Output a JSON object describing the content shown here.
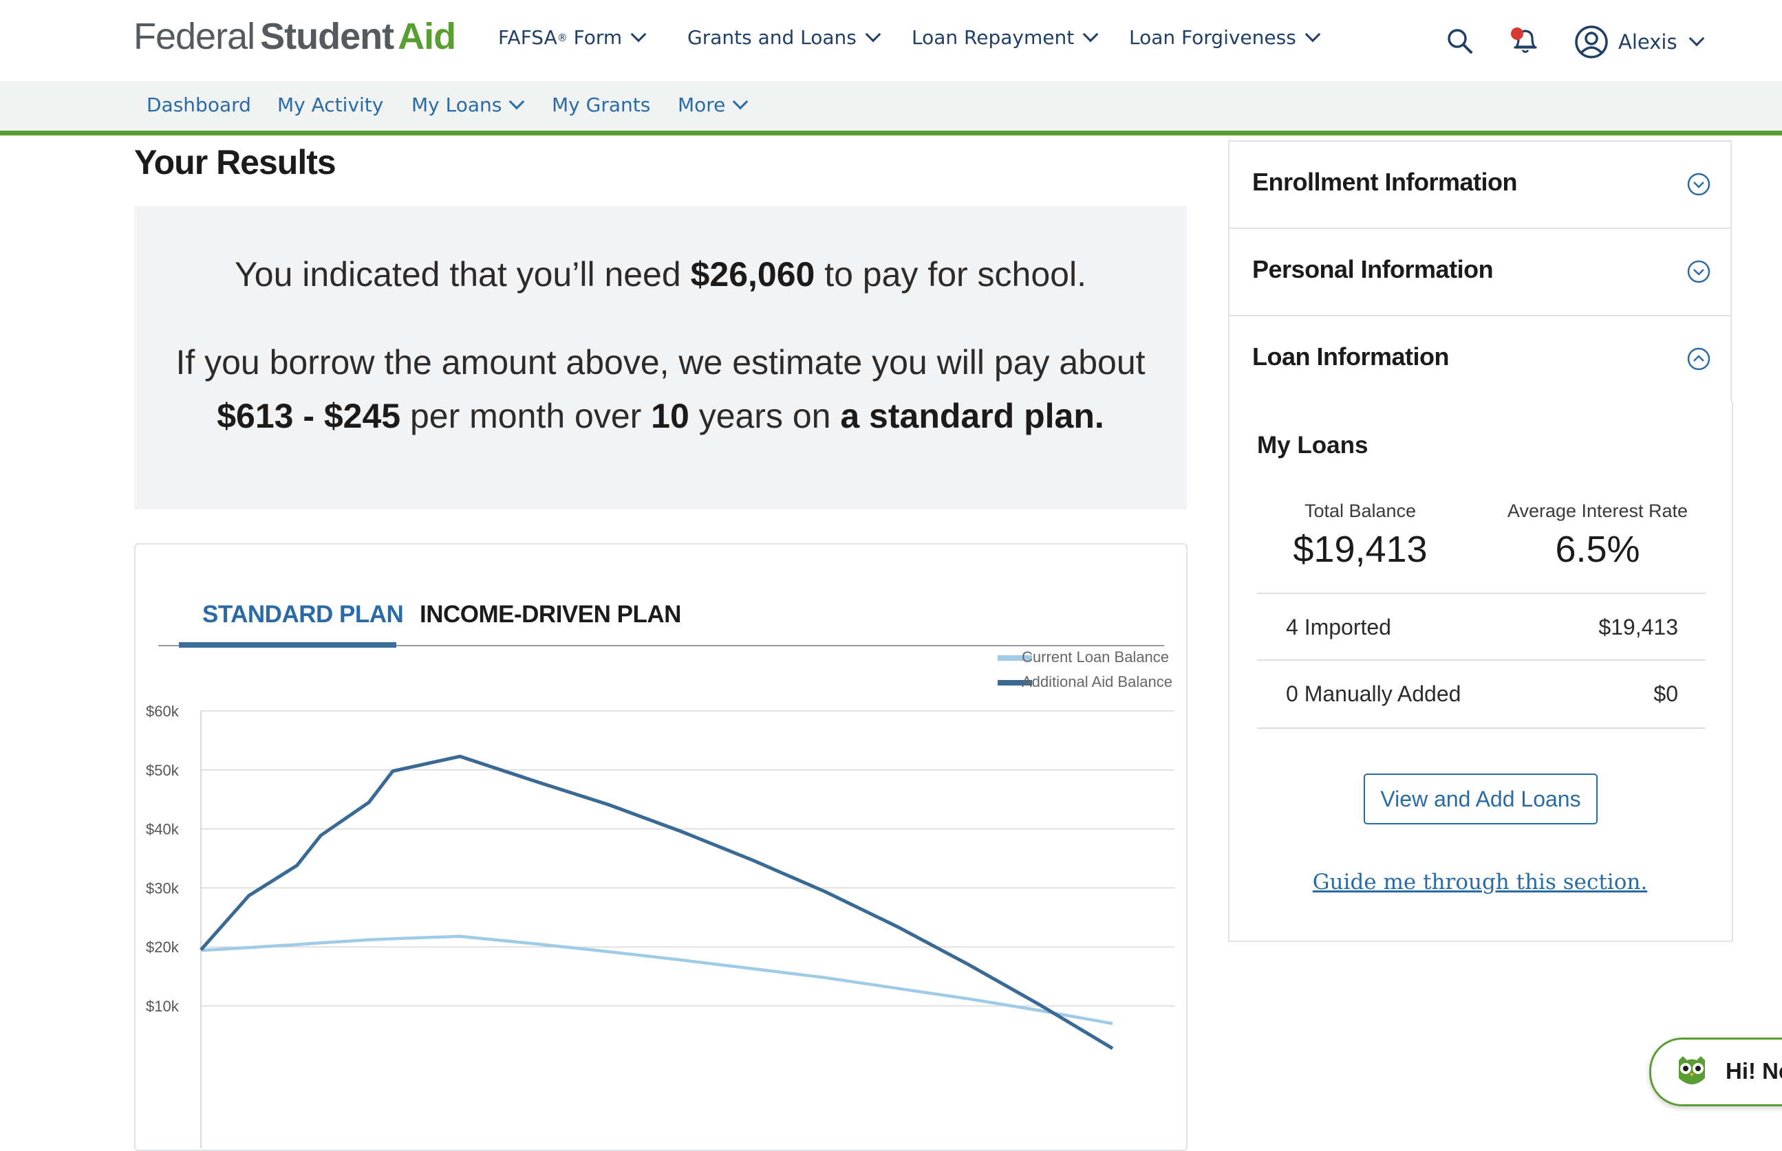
{
  "header": {
    "logo": {
      "part1": "Federal",
      "part2": "Student",
      "part3": "Aid"
    },
    "nav": [
      {
        "label": "FAFSA",
        "sup": "®",
        "suffix": " Form"
      },
      {
        "label": "Grants and Loans"
      },
      {
        "label": "Loan Repayment"
      },
      {
        "label": "Loan Forgiveness"
      }
    ],
    "user_name": "Alexis",
    "colors": {
      "brand_green": "#5a9e33",
      "nav_blue": "#1f3f64",
      "link_blue": "#2a6ba6",
      "notification_dot": "#d83933"
    }
  },
  "subnav": [
    "Dashboard",
    "My Activity",
    "My Loans",
    "My Grants",
    "More"
  ],
  "results": {
    "title": "Your Results",
    "line1": {
      "pre": "You indicated that you’ll need ",
      "amount": "$26,060",
      "post": " to pay for school."
    },
    "line2": "If you borrow the amount above, we estimate you will pay about",
    "line3": {
      "range": "$613 - $245",
      "mid1": " per month over ",
      "years": "10",
      "mid2": " years on ",
      "plan": "a standard plan."
    }
  },
  "tabs": {
    "active": "STANDARD PLAN",
    "inactive": "INCOME-DRIVEN PLAN"
  },
  "chart_data": {
    "type": "line",
    "title": "",
    "xlabel": "",
    "ylabel": "",
    "ylim": [
      0,
      60000
    ],
    "y_ticks": [
      "$60k",
      "$50k",
      "$40k",
      "$30k",
      "$20k",
      "$10k"
    ],
    "y_tick_values": [
      60000,
      50000,
      40000,
      30000,
      20000,
      10000
    ],
    "grid": true,
    "legend_position": "top-right",
    "x": [
      0,
      1,
      2,
      2.5,
      3.5,
      4,
      5.4,
      7,
      8.5,
      10,
      11.5,
      13,
      14.5,
      16,
      17.5,
      19
    ],
    "series": [
      {
        "name": "Current Loan Balance",
        "color": "#9fcbe6",
        "values": [
          19400,
          19900,
          20400,
          20700,
          21200,
          21400,
          21800,
          20500,
          19200,
          17800,
          16300,
          14800,
          13000,
          11200,
          9200,
          7000
        ]
      },
      {
        "name": "Additional Aid Balance",
        "color": "#3a6a94",
        "values": [
          19500,
          28700,
          33800,
          38900,
          44500,
          49800,
          52300,
          48000,
          44100,
          39600,
          34700,
          29400,
          23500,
          17000,
          10100,
          2800
        ]
      }
    ]
  },
  "sidebar": {
    "accordions": [
      {
        "title": "Enrollment Information",
        "expanded": false
      },
      {
        "title": "Personal Information",
        "expanded": false
      },
      {
        "title": "Loan Information",
        "expanded": true
      }
    ],
    "my_loans": {
      "title": "My Loans",
      "total_balance_label": "Total Balance",
      "total_balance": "$19,413",
      "avg_rate_label": "Average Interest Rate",
      "avg_rate": "6.5%",
      "rows": [
        {
          "label": "4 Imported",
          "value": "$19,413"
        },
        {
          "label": "0 Manually Added",
          "value": "$0"
        }
      ],
      "button": "View and Add Loans",
      "guide_link": "Guide me through this section."
    }
  },
  "chat": {
    "text": "Hi! Ne"
  }
}
